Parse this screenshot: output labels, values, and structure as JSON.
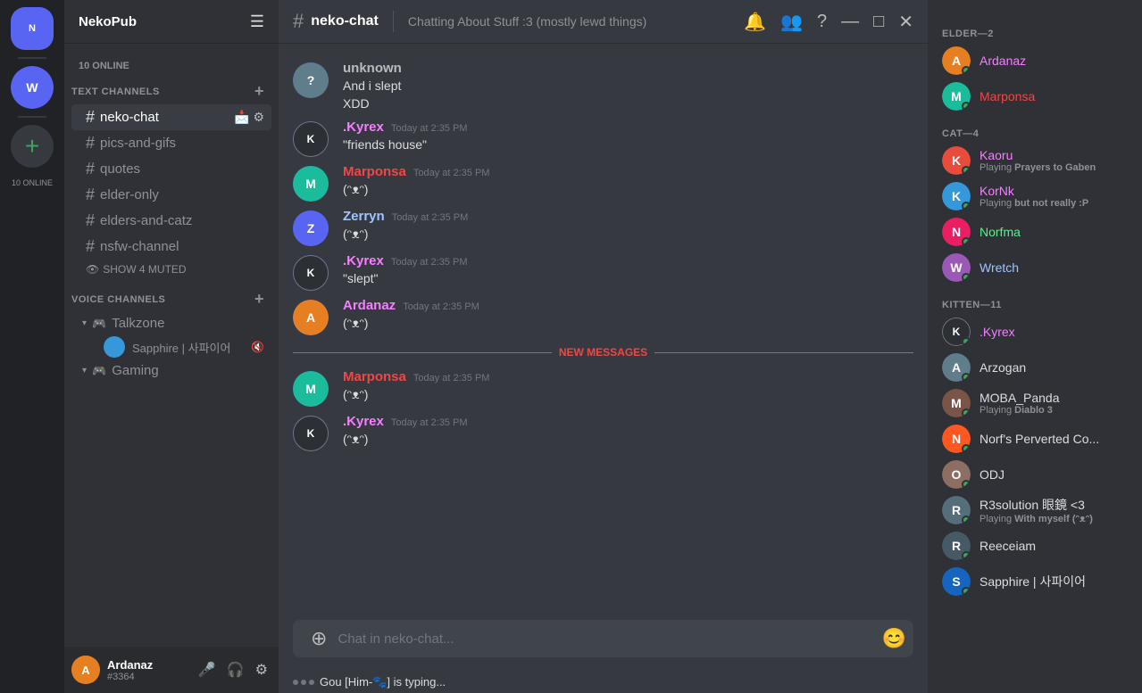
{
  "serverList": {
    "servers": [
      {
        "id": "nekopub",
        "initials": "N",
        "color": "#5865f2",
        "active": true
      },
      {
        "id": "server2",
        "initials": "W",
        "color": "#3ba55d"
      }
    ]
  },
  "sidebar": {
    "serverName": "NekoPub",
    "onlineCount": "10 ONLINE",
    "textChannels": {
      "sectionLabel": "TEXT CHANNELS",
      "channels": [
        {
          "name": "neko-chat",
          "active": true
        },
        {
          "name": "pics-and-gifs",
          "active": false
        },
        {
          "name": "quotes",
          "active": false
        },
        {
          "name": "elder-only",
          "active": false
        },
        {
          "name": "elders-and-catz",
          "active": false
        },
        {
          "name": "nsfw-channel",
          "active": false
        }
      ],
      "showMuted": "SHOW 4 MUTED"
    },
    "voiceChannels": {
      "sectionLabel": "VOICE CHANNELS",
      "channels": [
        {
          "name": "Talkzone",
          "users": [
            {
              "name": "Sapphire | 사파이어",
              "muted": true
            }
          ]
        },
        {
          "name": "Gaming",
          "users": []
        }
      ]
    }
  },
  "userPanel": {
    "name": "Ardanaz",
    "tag": "#3364"
  },
  "chat": {
    "channelName": "neko-chat",
    "channelTopic": "Chatting About Stuff :3 (mostly lewd things)",
    "messages": [
      {
        "author": "unknown",
        "authorColor": "#b9bbbe",
        "time": "",
        "lines": [
          "And i slept",
          "XDD"
        ],
        "avatarColor": "#607d8b",
        "avatarInitial": "?"
      },
      {
        "author": ".Kyrex",
        "authorColor": "#f47fff",
        "time": "Today at 2:35 PM",
        "lines": [
          "\"friends house\""
        ],
        "avatarColor": "#2c2f33",
        "avatarInitial": "K"
      },
      {
        "author": "Marponsa",
        "authorColor": "#f04747",
        "time": "Today at 2:35 PM",
        "lines": [
          "(ᵔᴥᵔ)"
        ],
        "avatarColor": "#1abc9c",
        "avatarInitial": "M"
      },
      {
        "author": "Zerryn",
        "authorColor": "#a0c4ff",
        "time": "Today at 2:35 PM",
        "lines": [
          "(ᵔᴥᵔ)"
        ],
        "avatarColor": "#5865f2",
        "avatarInitial": "Z"
      },
      {
        "author": ".Kyrex",
        "authorColor": "#f47fff",
        "time": "Today at 2:35 PM",
        "lines": [
          "\"slept\""
        ],
        "avatarColor": "#2c2f33",
        "avatarInitial": "K"
      },
      {
        "author": "Ardanaz",
        "authorColor": "#f47fff",
        "time": "Today at 2:35 PM",
        "lines": [
          "(ᵔᴥᵔ)"
        ],
        "avatarColor": "#e67e22",
        "avatarInitial": "A"
      }
    ],
    "newMessagesDivider": "NEW MESSAGES",
    "newMessages": [
      {
        "author": "Marponsa",
        "authorColor": "#f04747",
        "time": "Today at 2:35 PM",
        "lines": [
          "(ᵔᴥᵔ)"
        ],
        "avatarColor": "#1abc9c",
        "avatarInitial": "M"
      },
      {
        "author": ".Kyrex",
        "authorColor": "#f47fff",
        "time": "Today at 2:35 PM",
        "lines": [
          "(ᵔᴥᵔ)"
        ],
        "avatarColor": "#2c2f33",
        "avatarInitial": "K"
      }
    ],
    "inputPlaceholder": "Chat in neko-chat...",
    "typingText": "Gou [Him-🐾] is typing..."
  },
  "members": {
    "sections": [
      {
        "title": "ELDER—2",
        "members": [
          {
            "name": "Ardanaz",
            "nameColor": "#f47fff",
            "status": "online",
            "avatarColor": "#e67e22",
            "avatarInitial": "A"
          },
          {
            "name": "Marponsa",
            "nameColor": "#f04747",
            "status": "online",
            "avatarColor": "#1abc9c",
            "avatarInitial": "M"
          }
        ]
      },
      {
        "title": "CAT—4",
        "members": [
          {
            "name": "Kaoru",
            "nameColor": "#f47fff",
            "status": "online",
            "statusText": "Playing ",
            "statusGame": "Prayers to Gaben",
            "avatarColor": "#e74c3c",
            "avatarInitial": "K"
          },
          {
            "name": "KorNk",
            "nameColor": "#f47fff",
            "status": "online",
            "statusText": "Playing ",
            "statusGame": "but not really :P",
            "avatarColor": "#3498db",
            "avatarInitial": "K"
          },
          {
            "name": "Norfma",
            "nameColor": "#57f287",
            "status": "online",
            "avatarColor": "#e91e63",
            "avatarInitial": "N"
          },
          {
            "name": "Wretch",
            "nameColor": "#a0c4ff",
            "status": "online",
            "avatarColor": "#9b59b6",
            "avatarInitial": "W"
          }
        ]
      },
      {
        "title": "KITTEN—11",
        "members": [
          {
            "name": ".Kyrex",
            "nameColor": "#f47fff",
            "status": "online",
            "avatarColor": "#2c2f33",
            "avatarInitial": "K"
          },
          {
            "name": "Arzogan",
            "nameColor": "#b9bbbe",
            "status": "online",
            "avatarColor": "#607d8b",
            "avatarInitial": "A"
          },
          {
            "name": "MOBA_Panda",
            "nameColor": "#b9bbbe",
            "status": "online",
            "statusText": "Playing ",
            "statusGame": "Diablo 3",
            "avatarColor": "#795548",
            "avatarInitial": "M"
          },
          {
            "name": "Norf's Perverted Co...",
            "nameColor": "#b9bbbe",
            "status": "online",
            "avatarColor": "#ff5722",
            "avatarInitial": "N"
          },
          {
            "name": "ODJ",
            "nameColor": "#b9bbbe",
            "status": "online",
            "avatarColor": "#8d6e63",
            "avatarInitial": "O"
          },
          {
            "name": "R3solution 眼鏡 <3",
            "nameColor": "#b9bbbe",
            "status": "online",
            "statusText": "Playing ",
            "statusGame": "With myself (ᵔᴥᵔ)",
            "avatarColor": "#546e7a",
            "avatarInitial": "R"
          },
          {
            "name": "Reeceiam",
            "nameColor": "#b9bbbe",
            "status": "online",
            "avatarColor": "#455a64",
            "avatarInitial": "R"
          },
          {
            "name": "Sapphire | 사파이어",
            "nameColor": "#b9bbbe",
            "status": "online",
            "avatarColor": "#1565c0",
            "avatarInitial": "S"
          }
        ]
      }
    ]
  },
  "icons": {
    "hash": "#",
    "plus": "+",
    "bell": "🔔",
    "members": "👥",
    "question": "?",
    "minimize": "—",
    "maximize": "□",
    "close": "✕",
    "hamburger": "☰",
    "upload": "⊕",
    "emoji": "😊",
    "chevronDown": "▾",
    "settings": "⚙",
    "mute": "🔇",
    "deafen": "🎧",
    "collapse": "▾",
    "eye": "👁",
    "invite": "📩"
  }
}
